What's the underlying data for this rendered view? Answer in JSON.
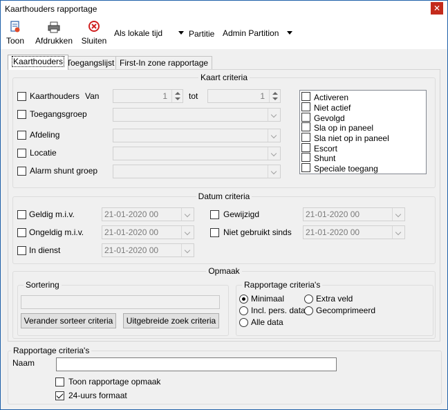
{
  "window": {
    "title": "Kaarthouders rapportage",
    "close_symbol": "✕"
  },
  "toolbar": {
    "toon": "Toon",
    "afdrukken": "Afdrukken",
    "sluiten": "Sluiten",
    "time_mode": "Als lokale tijd",
    "partitie_label": "Partitie",
    "partition_value": "Admin Partition"
  },
  "tabs": [
    "Kaarthouders",
    "Toegangslijst",
    "First-In zone rapportage"
  ],
  "kaart_criteria": {
    "title": "Kaart criteria",
    "kaarthouders": "Kaarthouders",
    "van": "Van",
    "tot": "tot",
    "van_value": "1",
    "tot_value": "1",
    "toegangsgroep": "Toegangsgroep",
    "afdeling": "Afdeling",
    "locatie": "Locatie",
    "alarm_shunt_groep": "Alarm shunt groep",
    "status_items": [
      "Activeren",
      "Niet actief",
      "Gevolgd",
      "Sla op in paneel",
      "Sla niet op in paneel",
      "Escort",
      "Shunt",
      "Speciale toegang"
    ]
  },
  "datum_criteria": {
    "title": "Datum criteria",
    "geldig": "Geldig m.i.v.",
    "ongeldig": "Ongeldig m.i.v.",
    "in_dienst": "In dienst",
    "gewijzigd": "Gewijzigd",
    "niet_gebruikt": "Niet gebruikt sinds",
    "date_value": "21-01-2020 00"
  },
  "opmaak": {
    "title": "Opmaak",
    "sortering": "Sortering",
    "verander_btn": "Verander sorteer criteria",
    "uitgebreide_btn": "Uitgebreide zoek criteria",
    "rapportage_title": "Rapportage criteria's",
    "minimaal": "Minimaal",
    "extra_veld": "Extra veld",
    "incl_pers": "Incl. pers. data",
    "gecomprimeerd": "Gecomprimeerd",
    "alle_data": "Alle data"
  },
  "report": {
    "title": "Rapportage criteria's",
    "naam": "Naam",
    "naam_value": "",
    "toon_opmaak": "Toon rapportage opmaak",
    "uurs_formaat": "24-uurs formaat"
  },
  "colors": {
    "close_red": "#c42b1c",
    "window_border": "#1d5fa8"
  }
}
